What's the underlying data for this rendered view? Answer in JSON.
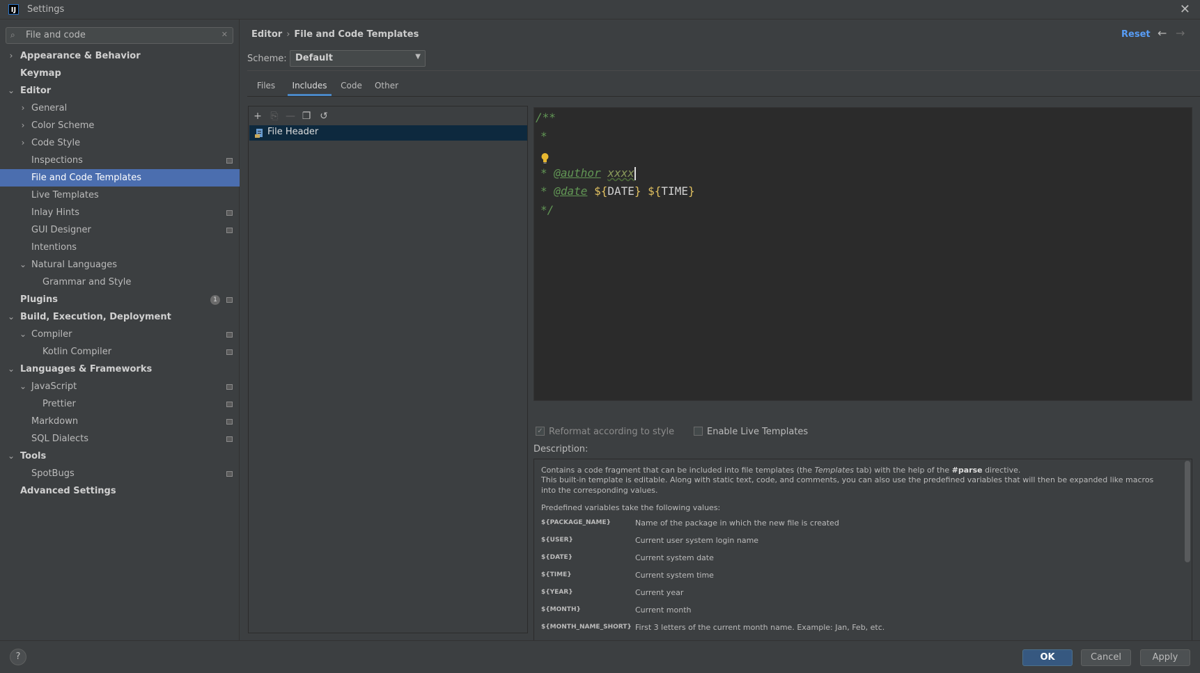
{
  "window": {
    "title": "Settings",
    "logo": "IJ"
  },
  "search": {
    "value": "File and code"
  },
  "sidebar": {
    "items": [
      {
        "label": "Appearance & Behavior",
        "arrow": "›"
      },
      {
        "label": "Keymap"
      },
      {
        "label": "Editor",
        "arrow": "⌄"
      },
      {
        "label": "General",
        "arrow": "›"
      },
      {
        "label": "Color Scheme",
        "arrow": "›"
      },
      {
        "label": "Code Style",
        "arrow": "›"
      },
      {
        "label": "Inspections"
      },
      {
        "label": "File and Code Templates"
      },
      {
        "label": "Live Templates"
      },
      {
        "label": "Inlay Hints"
      },
      {
        "label": "GUI Designer"
      },
      {
        "label": "Intentions"
      },
      {
        "label": "Natural Languages",
        "arrow": "⌄"
      },
      {
        "label": "Grammar and Style"
      },
      {
        "label": "Plugins",
        "badge": "1"
      },
      {
        "label": "Build, Execution, Deployment",
        "arrow": "⌄"
      },
      {
        "label": "Compiler",
        "arrow": "⌄"
      },
      {
        "label": "Kotlin Compiler"
      },
      {
        "label": "Languages & Frameworks",
        "arrow": "⌄"
      },
      {
        "label": "JavaScript",
        "arrow": "⌄"
      },
      {
        "label": "Prettier"
      },
      {
        "label": "Markdown"
      },
      {
        "label": "SQL Dialects"
      },
      {
        "label": "Tools",
        "arrow": "⌄"
      },
      {
        "label": "SpotBugs"
      },
      {
        "label": "Advanced Settings"
      }
    ]
  },
  "header": {
    "breadcrumb_parent": "Editor",
    "breadcrumb_sep": "›",
    "breadcrumb_current": "File and Code Templates",
    "reset_label": "Reset",
    "back_icon": "←",
    "forward_icon": "→"
  },
  "scheme": {
    "label": "Scheme:",
    "value": "Default"
  },
  "tabs": [
    "Files",
    "Includes",
    "Code",
    "Other"
  ],
  "active_tab": "Includes",
  "templates": {
    "items": [
      {
        "label": "File Header"
      }
    ]
  },
  "editor": {
    "line1": "/**",
    "line2": "*",
    "line4_star": "* ",
    "author_tag": "@author",
    "author_value": "xxxx",
    "line5_star": "* ",
    "date_tag": "@date",
    "date_var_open": "${",
    "date_var_name": "DATE",
    "date_var_close": "}",
    "time_var_open": "${",
    "time_var_name": "TIME",
    "time_var_close": "}",
    "line6": "*/"
  },
  "options": {
    "reformat_label": "Reformat according to style",
    "reformat_checked": true,
    "live_templates_label": "Enable Live Templates",
    "live_templates_checked": false
  },
  "description": {
    "label": "Description:",
    "para1_a": "Contains a code fragment that can be included into file templates (the ",
    "para1_templates": "Templates",
    "para1_b": " tab) with the help of the ",
    "para1_parse": "#parse",
    "para1_c": " directive.",
    "para2": "This built-in template is editable. Along with static text, code, and comments, you can also use the predefined variables that will then be expanded like macros into the corresponding values.",
    "para3": "Predefined variables take the following values:",
    "variables": [
      {
        "name": "${PACKAGE_NAME}",
        "desc": "Name of the package in which the new file is created"
      },
      {
        "name": "${USER}",
        "desc": "Current user system login name"
      },
      {
        "name": "${DATE}",
        "desc": "Current system date"
      },
      {
        "name": "${TIME}",
        "desc": "Current system time"
      },
      {
        "name": "${YEAR}",
        "desc": "Current year"
      },
      {
        "name": "${MONTH}",
        "desc": "Current month"
      },
      {
        "name": "${MONTH_NAME_SHORT}",
        "desc": "First 3 letters of the current month name. Example: Jan, Feb, etc."
      }
    ]
  },
  "footer": {
    "help": "?",
    "ok": "OK",
    "cancel": "Cancel",
    "apply": "Apply"
  },
  "colors": {
    "accent": "#4b6eaf",
    "link": "#589df6",
    "primary_button": "#365880",
    "editor_bg": "#2b2b2b",
    "comment": "#629755",
    "variable": "#ffc66d"
  }
}
